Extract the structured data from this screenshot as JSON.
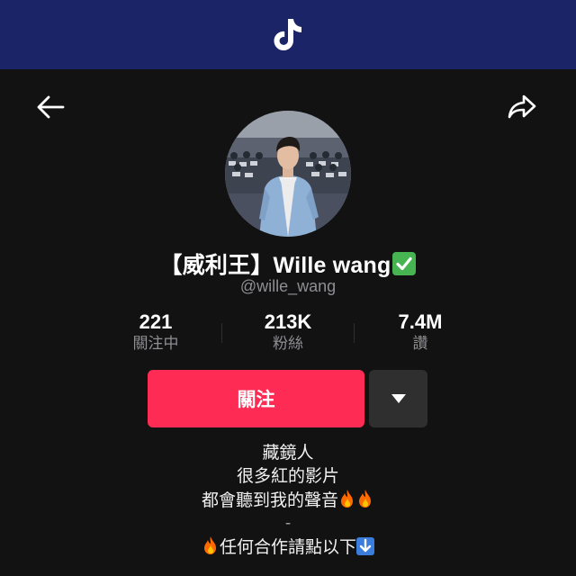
{
  "app": {
    "logo_icon": "tiktok-note-icon",
    "brand_bar_color": "#1b2466"
  },
  "header": {
    "back_icon": "back-arrow-icon",
    "share_icon": "share-arrow-icon"
  },
  "profile": {
    "display_name": "【威利王】Wille wang",
    "verified_icon": "check-mark-emoji",
    "handle": "@wille_wang"
  },
  "stats": [
    {
      "value": "221",
      "label": "關注中"
    },
    {
      "value": "213K",
      "label": "粉絲"
    },
    {
      "value": "7.4M",
      "label": "讚"
    }
  ],
  "actions": {
    "follow_label": "關注",
    "follow_color": "#fe2c55",
    "more_icon": "caret-down-icon"
  },
  "bio": {
    "line1": "藏鏡人",
    "line2": "很多紅的影片",
    "line3": "都會聽到我的聲音",
    "line4": "-",
    "line5": "任何合作請點以下",
    "emoji_fire": "fire-emoji",
    "emoji_down": "down-arrow-emoji"
  }
}
